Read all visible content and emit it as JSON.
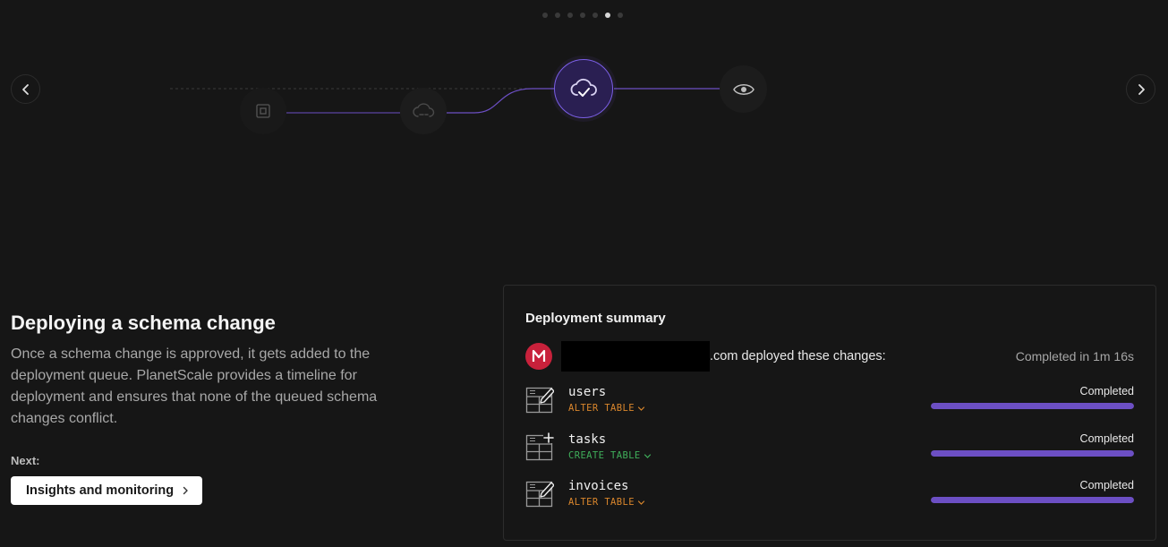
{
  "pagination": {
    "count": 7,
    "active_index": 5
  },
  "timeline": {
    "nodes": [
      {
        "icon": "copy-square-icon"
      },
      {
        "icon": "cloud-sync-icon"
      },
      {
        "icon": "cloud-check-icon",
        "active": true
      },
      {
        "icon": "eye-icon"
      }
    ],
    "accent": "#7b5fe6"
  },
  "intro": {
    "title": "Deploying a schema change",
    "body": "Once a schema change is approved, it gets added to the deployment queue. PlanetScale provides a timeline for deployment and ensures that none of the queued schema changes conflict.",
    "next_label": "Next:",
    "next_button": "Insights and monitoring"
  },
  "summary": {
    "title": "Deployment summary",
    "deploy_text": ".com deployed these changes:",
    "completed_in": "Completed in 1m 16s",
    "changes": [
      {
        "table": "users",
        "operation": "ALTER TABLE",
        "op_type": "alter",
        "status": "Completed",
        "progress": 1.0,
        "icon": "table-edit-icon"
      },
      {
        "table": "tasks",
        "operation": "CREATE TABLE",
        "op_type": "create",
        "status": "Completed",
        "progress": 1.0,
        "icon": "table-add-icon"
      },
      {
        "table": "invoices",
        "operation": "ALTER TABLE",
        "op_type": "alter",
        "status": "Completed",
        "progress": 1.0,
        "icon": "table-edit-icon"
      }
    ]
  },
  "colors": {
    "background": "#161616",
    "accent": "#6c4fc4",
    "alter": "#d9862c",
    "create": "#3fae5a"
  }
}
